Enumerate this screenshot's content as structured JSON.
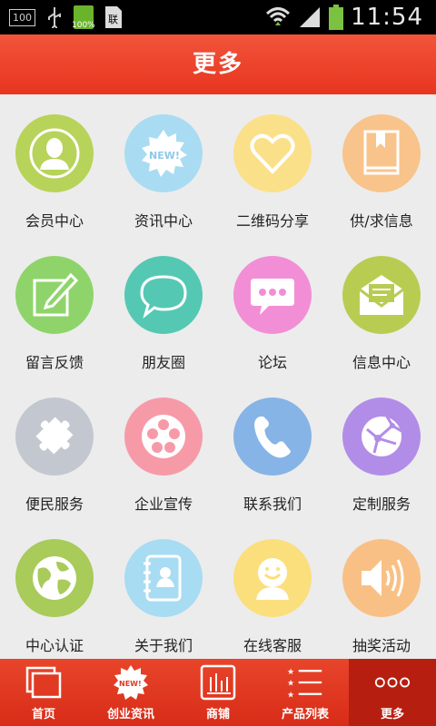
{
  "status_bar": {
    "left_box": "100",
    "battery_small_text": "100%",
    "time": "11:54",
    "icons": [
      "usb-icon",
      "battery-icon",
      "sim-icon",
      "wifi-icon",
      "signal-icon",
      "battery-full-icon"
    ]
  },
  "header": {
    "title": "更多"
  },
  "grid": {
    "items": [
      {
        "label": "会员中心",
        "icon": "member-icon",
        "color": "#b7d35a"
      },
      {
        "label": "资讯中心",
        "icon": "news-icon",
        "color": "#a9dcf2"
      },
      {
        "label": "二维码分享",
        "icon": "heart-icon",
        "color": "#fbe08a"
      },
      {
        "label": "供/求信息",
        "icon": "book-icon",
        "color": "#f8c48b"
      },
      {
        "label": "留言反馈",
        "icon": "edit-icon",
        "color": "#8fd46a"
      },
      {
        "label": "朋友圈",
        "icon": "chat-bubble-icon",
        "color": "#55c8b4"
      },
      {
        "label": "论坛",
        "icon": "forum-icon",
        "color": "#f28ed6"
      },
      {
        "label": "信息中心",
        "icon": "mail-icon",
        "color": "#b9cc52"
      },
      {
        "label": "便民服务",
        "icon": "puzzle-icon",
        "color": "#c3c7cf"
      },
      {
        "label": "企业宣传",
        "icon": "film-reel-icon",
        "color": "#f79aa8"
      },
      {
        "label": "联系我们",
        "icon": "phone-icon",
        "color": "#86b4e6"
      },
      {
        "label": "定制服务",
        "icon": "globe-network-icon",
        "color": "#b28de8"
      },
      {
        "label": "中心认证",
        "icon": "globe-icon",
        "color": "#a8cb59"
      },
      {
        "label": "关于我们",
        "icon": "contacts-icon",
        "color": "#a7dcf3"
      },
      {
        "label": "在线客服",
        "icon": "support-agent-icon",
        "color": "#fbdf7c"
      },
      {
        "label": "抽奖活动",
        "icon": "speaker-icon",
        "color": "#f9c085"
      }
    ]
  },
  "tabbar": {
    "tabs": [
      {
        "label": "首页",
        "icon": "home-icon"
      },
      {
        "label": "创业资讯",
        "icon": "new-badge-icon"
      },
      {
        "label": "商铺",
        "icon": "shop-icon"
      },
      {
        "label": "产品列表",
        "icon": "list-icon"
      },
      {
        "label": "更多",
        "icon": "more-icon",
        "active": true
      }
    ],
    "new_badge_text": "NEW!"
  },
  "news_badge_text": "NEW!"
}
